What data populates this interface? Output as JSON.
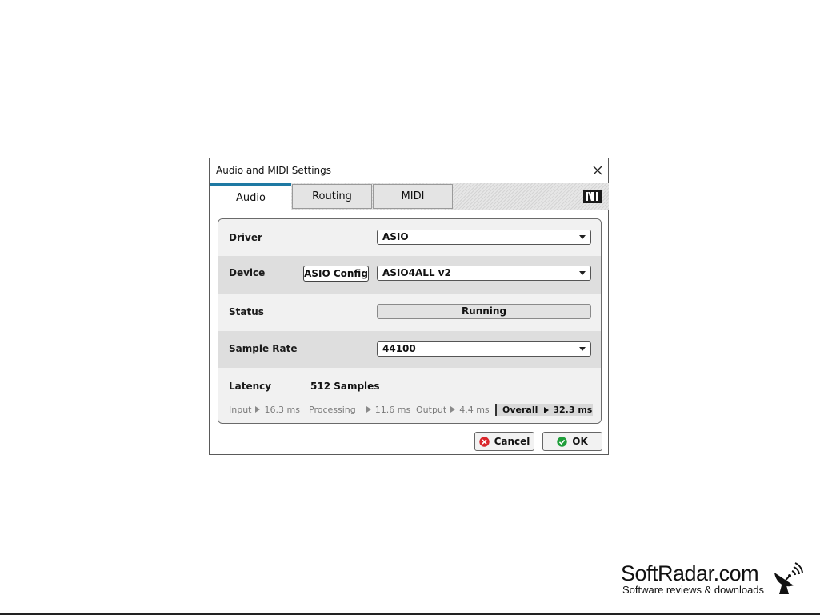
{
  "dialog": {
    "title": "Audio and MIDI Settings"
  },
  "tabs": [
    {
      "label": "Audio",
      "active": true
    },
    {
      "label": "Routing",
      "active": false
    },
    {
      "label": "MIDI",
      "active": false
    }
  ],
  "brand_logo": "NI",
  "settings": {
    "driver": {
      "label": "Driver",
      "value": "ASIO"
    },
    "device": {
      "label": "Device",
      "config_button": "ASIO Config",
      "value": "ASIO4ALL v2"
    },
    "status": {
      "label": "Status",
      "value": "Running"
    },
    "sample_rate": {
      "label": "Sample Rate",
      "value": "44100"
    },
    "latency": {
      "label": "Latency",
      "value": "512 Samples",
      "input_label": "Input",
      "input_value": "16.3 ms",
      "processing_label": "Processing",
      "processing_value": "11.6 ms",
      "output_label": "Output",
      "output_value": "4.4 ms",
      "overall_label": "Overall",
      "overall_value": "32.3 ms"
    }
  },
  "buttons": {
    "cancel": "Cancel",
    "ok": "OK"
  },
  "watermark": {
    "name": "SoftRadar.com",
    "tagline": "Software reviews & downloads"
  },
  "colors": {
    "active_tab_accent": "#1e79a3",
    "cancel_icon": "#d9262b",
    "ok_icon": "#1f9e3a"
  }
}
